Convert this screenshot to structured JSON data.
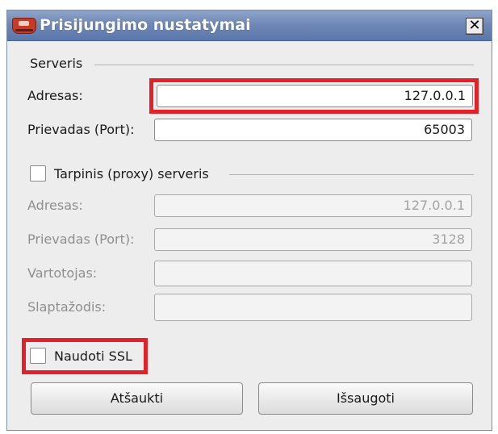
{
  "window": {
    "title": "Prisijungimo nustatymai",
    "close_glyph": "✕"
  },
  "server": {
    "group_title": "Serveris",
    "address_label": "Adresas:",
    "address_value": "127.0.0.1",
    "port_label": "Prievadas (Port):",
    "port_value": "65003"
  },
  "proxy": {
    "checkbox_label": "Tarpinis (proxy) serveris",
    "enabled": false,
    "address_label": "Adresas:",
    "address_value": "127.0.0.1",
    "port_label": "Prievadas (Port):",
    "port_value": "3128",
    "user_label": "Vartotojas:",
    "user_value": "",
    "password_label": "Slaptažodis:",
    "password_value": ""
  },
  "ssl": {
    "checkbox_label": "Naudoti SSL",
    "enabled": false
  },
  "buttons": {
    "cancel_label": "Atšaukti",
    "save_label": "Išsaugoti"
  },
  "colors": {
    "highlight": "#e1222b",
    "titlebar": "#6f88b6"
  }
}
